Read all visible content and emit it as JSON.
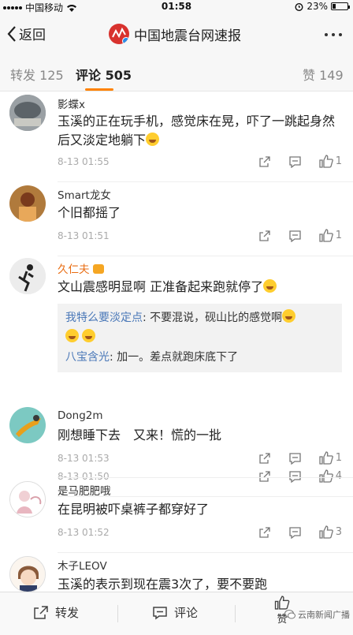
{
  "status_bar": {
    "carrier": "中国移动",
    "time": "01:58",
    "battery": "23%",
    "battery_level": 0.23
  },
  "header": {
    "back_label": "返回",
    "title": "中国地震台网速报"
  },
  "tabs": {
    "repost": "转发 125",
    "comments": "评论 505",
    "likes": "赞 149"
  },
  "comments": [
    {
      "name": "影蝶x",
      "text": "玉溪的正在玩手机，感觉床在晃，吓了一跳起身然后又淡定地躺下",
      "time": "8-13 01:55",
      "likes": "1"
    },
    {
      "name": "Smart龙女",
      "text": "个旧都摇了",
      "time": "8-13 01:51",
      "likes": "1"
    },
    {
      "name": "久仁夫",
      "text": "文山震感明显啊 正准备起来跑就停了",
      "time": "8-13 01:50",
      "likes": "4",
      "replies": [
        {
          "name": "我特么要淡定点",
          "text": ": 不要混说，砚山比的感觉啊"
        },
        {
          "name": "八宝含光",
          "text": ": 加一。差点就跑床底下了"
        }
      ]
    },
    {
      "name": "Dong2m",
      "text": "刚想睡下去　又来！慌的一批",
      "time": "8-13 01:53",
      "likes": "1"
    },
    {
      "name": "是马肥肥哦",
      "text": "在昆明被吓桌裤子都穿好了",
      "time": "8-13 01:52",
      "likes": "3"
    },
    {
      "name": "木子LEOV",
      "text": "玉溪的表示到现在震3次了，要不要跑",
      "time": "",
      "likes": ""
    }
  ],
  "bottom_bar": {
    "repost": "转发",
    "comment": "评论",
    "like": "赞",
    "watermark": "云南新闻广播"
  },
  "colors": {
    "accent": "#ff8200",
    "link": "#4a78b8",
    "vip_name": "#e86b10"
  }
}
